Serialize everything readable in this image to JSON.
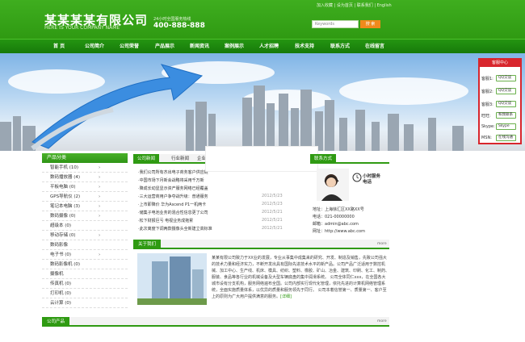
{
  "header": {
    "logo_cn": "某某某某有限公司",
    "logo_en": "HERE IS YOUR COMPANY NAME",
    "hotline_label": "24小时全国服务热线",
    "hotline_number": "400-888-888",
    "top_links": "加入收藏 | 设为首页 | 联系我们 | English",
    "search_placeholder": "Keywords",
    "search_button": "搜 索"
  },
  "nav": [
    "首 页",
    "公司简介",
    "公司荣誉",
    "产品展示",
    "新闻资讯",
    "案例展示",
    "人才招聘",
    "技术支持",
    "联系方式",
    "在线留言"
  ],
  "service": {
    "title": "客服中心",
    "rows": [
      {
        "label": "客服1:",
        "button": "QQ交谈"
      },
      {
        "label": "客服2:",
        "button": "QQ交谈"
      },
      {
        "label": "客服3:",
        "button": "QQ交谈"
      },
      {
        "label": "旺旺:",
        "button": "和我联系"
      },
      {
        "label": "Skype:",
        "button": "Skype"
      },
      {
        "label": "MSN:",
        "button": "在线沟通"
      }
    ]
  },
  "sidebar": {
    "title": "产品分类",
    "items": [
      "智能手机 (10)",
      "数码播放器 (4)",
      "平板电脑 (0)",
      "GPS导航仪 (2)",
      "笔记本电脑 (3)",
      "数码摄像 (0)",
      "超级本 (0)",
      "移动存储 (0)",
      "数码影像",
      "电子书 (0)",
      "数码影像机 (0)",
      "摄像机",
      "传真机 (0)",
      "打印机 (0)",
      "云计算 (0)"
    ]
  },
  "news": {
    "tabs": [
      "公司新闻",
      "行业新闻",
      "企业"
    ],
    "items": [
      {
        "title": "·我们公司所有杰出电子商务客户供应链",
        "date": ""
      },
      {
        "title": "·中国市场下月新会战略将采用千万新",
        "date": ""
      },
      {
        "title": "·降成长动显显示资产服务网络已经覆盖",
        "date": ""
      },
      {
        "title": "·三大运营商用户争夺战升级：普通服务",
        "date": "2012/5/23"
      },
      {
        "title": "·上市即降价 华为Ascend P1一机两卡",
        "date": "2012/5/23"
      },
      {
        "title": "·储集子电池业务的混合性信息更了公司",
        "date": "2012/5/21"
      },
      {
        "title": "·松下财报巨亏 电视业务成拖累",
        "date": "2012/5/21"
      },
      {
        "title": "·此次离度下调两款摄像头全新建立高标准",
        "date": "2012/5/21"
      }
    ]
  },
  "contact": {
    "title": "联系方式",
    "badge": "小时服务电话",
    "address": "地址：上海徐汇区XX路XX号",
    "phone": "电话：021-00000000",
    "email": "邮箱：admin@abc.com",
    "website": "网址：http://www.abc.com"
  },
  "about": {
    "title": "关于我们",
    "more": "more",
    "text": "某某有限公司致力于XX业的发展，专业从事集中成集来的研究、开发、制造及销售，先致公司强大的技术力量和经济实力，不断开发出具有国际先进技术水平的新产品。公司产品广泛适用于数控机械、加工中心、生产线、机床、模具、纺织、塑料、橡胶、矿山、冶金、建筑、印刷、化工、制药、服装、食品等各行业的机械设备及大型车辆底盘的集中润滑系统。 公司全体同仁xxx，在全国各大城市设有分支机构，服务网络遍布全国。公司内部实行现代化管理，依托先进的计算机网络管理系统，全面实施质量体系，以优异的质量和服务领先于同行。 公司本着信誉第一、质量第一、客户至上的原则为广大用户提供满意的服务。",
    "more_link": "[详细]"
  },
  "products": {
    "title": "公司产品",
    "more": "more"
  }
}
